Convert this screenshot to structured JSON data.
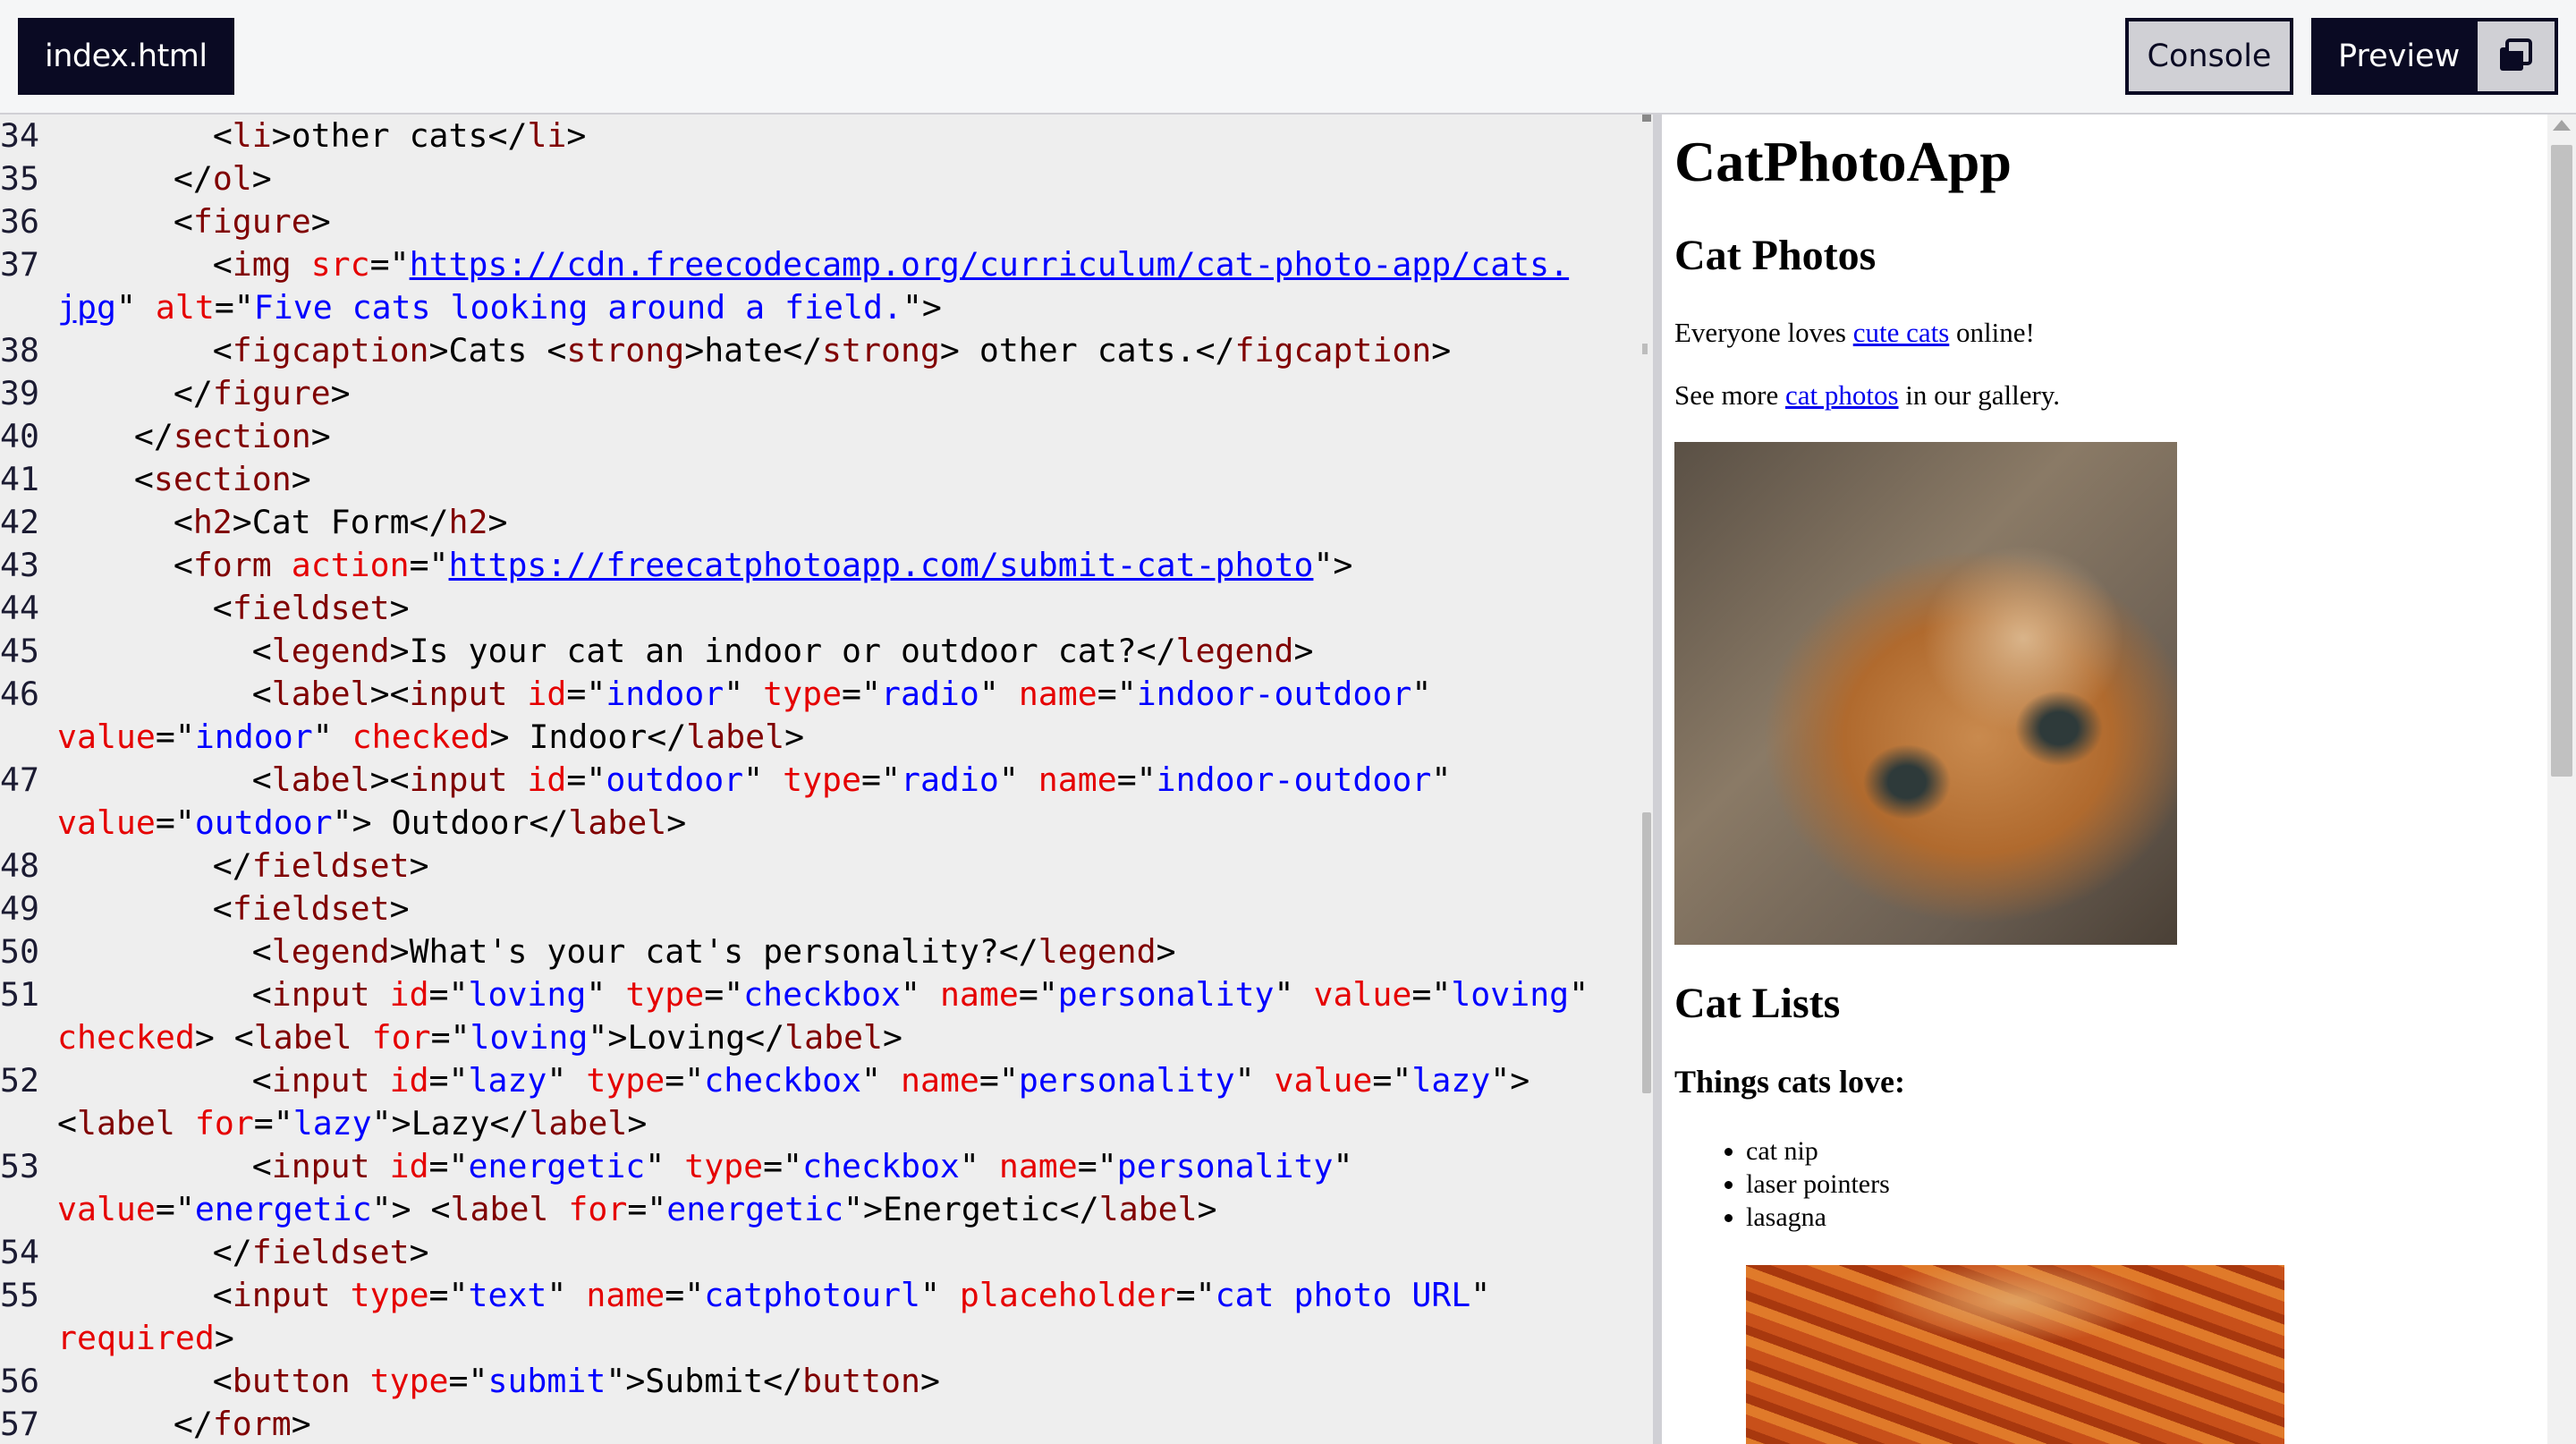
{
  "toolbar": {
    "file_tab": "index.html",
    "console_label": "Console",
    "preview_label": "Preview",
    "popout_icon": "window-popout-icon"
  },
  "editor": {
    "lines": [
      {
        "n": "34",
        "segs": [
          [
            "p",
            "        "
          ],
          [
            "p",
            "<"
          ],
          [
            "t",
            "li"
          ],
          [
            "p",
            ">other cats</"
          ],
          [
            "t",
            "li"
          ],
          [
            "p",
            ">"
          ]
        ]
      },
      {
        "n": "35",
        "segs": [
          [
            "p",
            "      </"
          ],
          [
            "t",
            "ol"
          ],
          [
            "p",
            ">"
          ]
        ]
      },
      {
        "n": "36",
        "segs": [
          [
            "p",
            "      <"
          ],
          [
            "t",
            "figure"
          ],
          [
            "p",
            ">"
          ]
        ]
      },
      {
        "n": "37",
        "segs": [
          [
            "p",
            "        <"
          ],
          [
            "t",
            "img"
          ],
          [
            "p",
            " "
          ],
          [
            "a",
            "src"
          ],
          [
            "p",
            "=\""
          ],
          [
            "u",
            "https://cdn.freecodecamp.org/curriculum/cat-photo-app/cats."
          ]
        ],
        "wrap": [
          [
            "u",
            "jpg"
          ],
          [
            "p",
            "\" "
          ],
          [
            "a",
            "alt"
          ],
          [
            "p",
            "=\""
          ],
          [
            "v",
            "Five cats looking around a field."
          ],
          [
            "p",
            "\">"
          ]
        ]
      },
      {
        "n": "38",
        "segs": [
          [
            "p",
            "        <"
          ],
          [
            "t",
            "figcaption"
          ],
          [
            "p",
            ">Cats <"
          ],
          [
            "t",
            "strong"
          ],
          [
            "p",
            ">hate</"
          ],
          [
            "t",
            "strong"
          ],
          [
            "p",
            "> other cats.</"
          ],
          [
            "t",
            "figcaption"
          ],
          [
            "p",
            ">"
          ]
        ]
      },
      {
        "n": "39",
        "segs": [
          [
            "p",
            "      </"
          ],
          [
            "t",
            "figure"
          ],
          [
            "p",
            ">"
          ]
        ]
      },
      {
        "n": "40",
        "segs": [
          [
            "p",
            "    </"
          ],
          [
            "t",
            "section"
          ],
          [
            "p",
            ">"
          ]
        ]
      },
      {
        "n": "41",
        "segs": [
          [
            "p",
            "    <"
          ],
          [
            "t",
            "section"
          ],
          [
            "p",
            ">"
          ]
        ]
      },
      {
        "n": "42",
        "segs": [
          [
            "p",
            "      <"
          ],
          [
            "t",
            "h2"
          ],
          [
            "p",
            ">Cat Form</"
          ],
          [
            "t",
            "h2"
          ],
          [
            "p",
            ">"
          ]
        ]
      },
      {
        "n": "43",
        "segs": [
          [
            "p",
            "      <"
          ],
          [
            "t",
            "form"
          ],
          [
            "p",
            " "
          ],
          [
            "a",
            "action"
          ],
          [
            "p",
            "=\""
          ],
          [
            "u",
            "https://freecatphotoapp.com/submit-cat-photo"
          ],
          [
            "p",
            "\">"
          ]
        ]
      },
      {
        "n": "44",
        "segs": [
          [
            "p",
            "        <"
          ],
          [
            "t",
            "fieldset"
          ],
          [
            "p",
            ">"
          ]
        ]
      },
      {
        "n": "45",
        "segs": [
          [
            "p",
            "          <"
          ],
          [
            "t",
            "legend"
          ],
          [
            "p",
            ">Is your cat an indoor or outdoor cat?</"
          ],
          [
            "t",
            "legend"
          ],
          [
            "p",
            ">"
          ]
        ]
      },
      {
        "n": "46",
        "segs": [
          [
            "p",
            "          <"
          ],
          [
            "t",
            "label"
          ],
          [
            "p",
            "><"
          ],
          [
            "t",
            "input"
          ],
          [
            "p",
            " "
          ],
          [
            "a",
            "id"
          ],
          [
            "p",
            "=\""
          ],
          [
            "v",
            "indoor"
          ],
          [
            "p",
            "\" "
          ],
          [
            "a",
            "type"
          ],
          [
            "p",
            "=\""
          ],
          [
            "v",
            "radio"
          ],
          [
            "p",
            "\" "
          ],
          [
            "a",
            "name"
          ],
          [
            "p",
            "=\""
          ],
          [
            "v",
            "indoor-outdoor"
          ],
          [
            "p",
            "\""
          ]
        ],
        "wrap": [
          [
            "a",
            "value"
          ],
          [
            "p",
            "=\""
          ],
          [
            "v",
            "indoor"
          ],
          [
            "p",
            "\" "
          ],
          [
            "a",
            "checked"
          ],
          [
            "p",
            "> Indoor</"
          ],
          [
            "t",
            "label"
          ],
          [
            "p",
            ">"
          ]
        ]
      },
      {
        "n": "47",
        "segs": [
          [
            "p",
            "          <"
          ],
          [
            "t",
            "label"
          ],
          [
            "p",
            "><"
          ],
          [
            "t",
            "input"
          ],
          [
            "p",
            " "
          ],
          [
            "a",
            "id"
          ],
          [
            "p",
            "=\""
          ],
          [
            "v",
            "outdoor"
          ],
          [
            "p",
            "\" "
          ],
          [
            "a",
            "type"
          ],
          [
            "p",
            "=\""
          ],
          [
            "v",
            "radio"
          ],
          [
            "p",
            "\" "
          ],
          [
            "a",
            "name"
          ],
          [
            "p",
            "=\""
          ],
          [
            "v",
            "indoor-outdoor"
          ],
          [
            "p",
            "\""
          ]
        ],
        "wrap": [
          [
            "a",
            "value"
          ],
          [
            "p",
            "=\""
          ],
          [
            "v",
            "outdoor"
          ],
          [
            "p",
            "\"> Outdoor</"
          ],
          [
            "t",
            "label"
          ],
          [
            "p",
            ">"
          ]
        ]
      },
      {
        "n": "48",
        "segs": [
          [
            "p",
            "        </"
          ],
          [
            "t",
            "fieldset"
          ],
          [
            "p",
            ">"
          ]
        ]
      },
      {
        "n": "49",
        "segs": [
          [
            "p",
            "        <"
          ],
          [
            "t",
            "fieldset"
          ],
          [
            "p",
            ">"
          ]
        ]
      },
      {
        "n": "50",
        "segs": [
          [
            "p",
            "          <"
          ],
          [
            "t",
            "legend"
          ],
          [
            "p",
            ">What's your cat's personality?</"
          ],
          [
            "t",
            "legend"
          ],
          [
            "p",
            ">"
          ]
        ]
      },
      {
        "n": "51",
        "segs": [
          [
            "p",
            "          <"
          ],
          [
            "t",
            "input"
          ],
          [
            "p",
            " "
          ],
          [
            "a",
            "id"
          ],
          [
            "p",
            "=\""
          ],
          [
            "v",
            "loving"
          ],
          [
            "p",
            "\" "
          ],
          [
            "a",
            "type"
          ],
          [
            "p",
            "=\""
          ],
          [
            "v",
            "checkbox"
          ],
          [
            "p",
            "\" "
          ],
          [
            "a",
            "name"
          ],
          [
            "p",
            "=\""
          ],
          [
            "v",
            "personality"
          ],
          [
            "p",
            "\" "
          ],
          [
            "a",
            "value"
          ],
          [
            "p",
            "=\""
          ],
          [
            "v",
            "loving"
          ],
          [
            "p",
            "\""
          ]
        ],
        "wrap": [
          [
            "a",
            "checked"
          ],
          [
            "p",
            "> <"
          ],
          [
            "t",
            "label"
          ],
          [
            "p",
            " "
          ],
          [
            "a",
            "for"
          ],
          [
            "p",
            "=\""
          ],
          [
            "v",
            "loving"
          ],
          [
            "p",
            "\">Loving</"
          ],
          [
            "t",
            "label"
          ],
          [
            "p",
            ">"
          ]
        ]
      },
      {
        "n": "52",
        "segs": [
          [
            "p",
            "          <"
          ],
          [
            "t",
            "input"
          ],
          [
            "p",
            " "
          ],
          [
            "a",
            "id"
          ],
          [
            "p",
            "=\""
          ],
          [
            "v",
            "lazy"
          ],
          [
            "p",
            "\" "
          ],
          [
            "a",
            "type"
          ],
          [
            "p",
            "=\""
          ],
          [
            "v",
            "checkbox"
          ],
          [
            "p",
            "\" "
          ],
          [
            "a",
            "name"
          ],
          [
            "p",
            "=\""
          ],
          [
            "v",
            "personality"
          ],
          [
            "p",
            "\" "
          ],
          [
            "a",
            "value"
          ],
          [
            "p",
            "=\""
          ],
          [
            "v",
            "lazy"
          ],
          [
            "p",
            "\">"
          ]
        ],
        "wrap": [
          [
            "p",
            "<"
          ],
          [
            "t",
            "label"
          ],
          [
            "p",
            " "
          ],
          [
            "a",
            "for"
          ],
          [
            "p",
            "=\""
          ],
          [
            "v",
            "lazy"
          ],
          [
            "p",
            "\">Lazy</"
          ],
          [
            "t",
            "label"
          ],
          [
            "p",
            ">"
          ]
        ]
      },
      {
        "n": "53",
        "segs": [
          [
            "p",
            "          <"
          ],
          [
            "t",
            "input"
          ],
          [
            "p",
            " "
          ],
          [
            "a",
            "id"
          ],
          [
            "p",
            "=\""
          ],
          [
            "v",
            "energetic"
          ],
          [
            "p",
            "\" "
          ],
          [
            "a",
            "type"
          ],
          [
            "p",
            "=\""
          ],
          [
            "v",
            "checkbox"
          ],
          [
            "p",
            "\" "
          ],
          [
            "a",
            "name"
          ],
          [
            "p",
            "=\""
          ],
          [
            "v",
            "personality"
          ],
          [
            "p",
            "\""
          ]
        ],
        "wrap": [
          [
            "a",
            "value"
          ],
          [
            "p",
            "=\""
          ],
          [
            "v",
            "energetic"
          ],
          [
            "p",
            "\"> <"
          ],
          [
            "t",
            "label"
          ],
          [
            "p",
            " "
          ],
          [
            "a",
            "for"
          ],
          [
            "p",
            "=\""
          ],
          [
            "v",
            "energetic"
          ],
          [
            "p",
            "\">Energetic</"
          ],
          [
            "t",
            "label"
          ],
          [
            "p",
            ">"
          ]
        ]
      },
      {
        "n": "54",
        "segs": [
          [
            "p",
            "        </"
          ],
          [
            "t",
            "fieldset"
          ],
          [
            "p",
            ">"
          ]
        ]
      },
      {
        "n": "55",
        "segs": [
          [
            "p",
            "        <"
          ],
          [
            "t",
            "input"
          ],
          [
            "p",
            " "
          ],
          [
            "a",
            "type"
          ],
          [
            "p",
            "=\""
          ],
          [
            "v",
            "text"
          ],
          [
            "p",
            "\" "
          ],
          [
            "a",
            "name"
          ],
          [
            "p",
            "=\""
          ],
          [
            "v",
            "catphotourl"
          ],
          [
            "p",
            "\" "
          ],
          [
            "a",
            "placeholder"
          ],
          [
            "p",
            "=\""
          ],
          [
            "v",
            "cat photo URL"
          ],
          [
            "p",
            "\""
          ]
        ],
        "wrap": [
          [
            "a",
            "required"
          ],
          [
            "p",
            ">"
          ]
        ]
      },
      {
        "n": "56",
        "segs": [
          [
            "p",
            "        <"
          ],
          [
            "t",
            "button"
          ],
          [
            "p",
            " "
          ],
          [
            "a",
            "type"
          ],
          [
            "p",
            "=\""
          ],
          [
            "v",
            "submit"
          ],
          [
            "p",
            "\">Submit</"
          ],
          [
            "t",
            "button"
          ],
          [
            "p",
            ">"
          ]
        ]
      },
      {
        "n": "57",
        "segs": [
          [
            "p",
            "      </"
          ],
          [
            "t",
            "form"
          ],
          [
            "p",
            ">"
          ]
        ]
      }
    ]
  },
  "preview": {
    "h1": "CatPhotoApp",
    "h2_photos": "Cat Photos",
    "p1_before": "Everyone loves ",
    "p1_link": "cute cats",
    "p1_after": " online!",
    "p2_before": "See more ",
    "p2_link": "cat photos",
    "p2_after": " in our gallery.",
    "h2_lists": "Cat Lists",
    "h3_love": "Things cats love:",
    "love_items": [
      "cat nip",
      "laser pointers",
      "lasagna"
    ]
  },
  "colors": {
    "accent_dark": "#0a0a23",
    "button_gray": "#d0d0d5",
    "tag": "#800000",
    "attribute": "#e50000",
    "value": "#0000ff",
    "link": "#0000ee"
  }
}
